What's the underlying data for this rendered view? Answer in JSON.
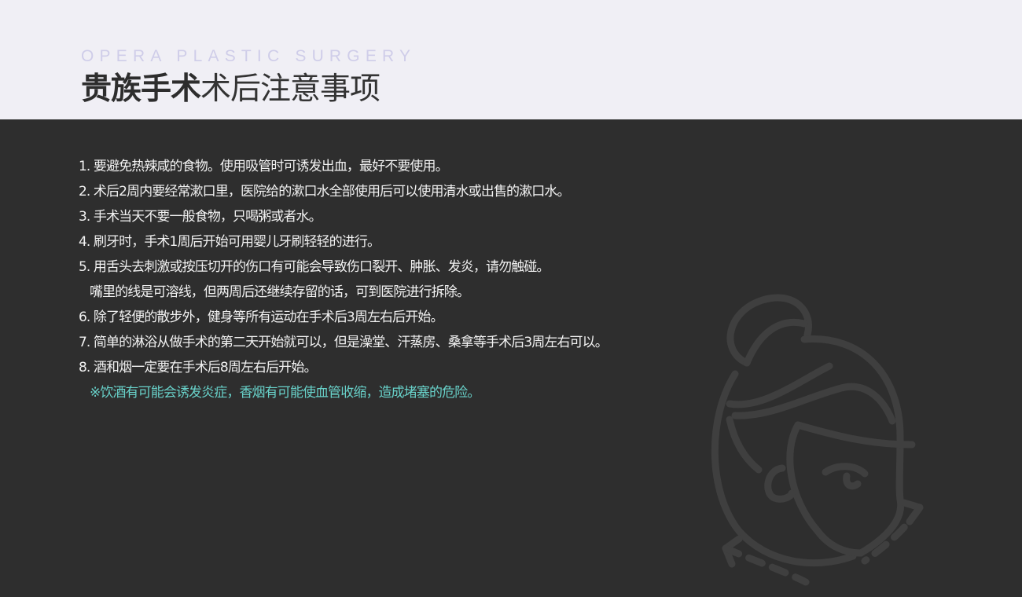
{
  "header": {
    "brand_en": "OPERA PLASTIC SURGERY",
    "title_bold": "贵族手术",
    "title_light": "术后注意事项"
  },
  "notes": [
    "1. 要避免热辣咸的食物。使用吸管时可诱发出血，最好不要使用。",
    "2. 术后2周内要经常漱口里，医院给的漱口水全部使用后可以使用清水或出售的漱口水。",
    "3. 手术当天不要一般食物，只喝粥或者水。",
    "4. 刷牙时，手术1周后开始可用婴儿牙刷轻轻的进行。",
    "5. 用舌头去刺激或按压切开的伤口有可能会导致伤口裂开、肿胀、发炎，请勿触碰。",
    "嘴里的线是可溶线，但两周后还继续存留的话，可到医院进行拆除。",
    "6. 除了轻便的散步外，健身等所有运动在手术后3周左右后开始。",
    "7. 简单的淋浴从做手术的第二天开始就可以，但是澡堂、汗蒸房、桑拿等手术后3周左右可以。",
    "8. 酒和烟一定要在手术后8周左右后开始。",
    "※饮酒有可能会诱发炎症，香烟有可能使血管收缩，造成堵塞的危险。"
  ],
  "colors": {
    "header_bg": "#f0eff5",
    "content_bg": "#2e2e2e",
    "brand_en": "#cfcde9",
    "warning": "#68d1c9",
    "illustration_stroke": "#3f3f3f"
  },
  "icons": {
    "illustration": "woman-face-line-icon"
  }
}
